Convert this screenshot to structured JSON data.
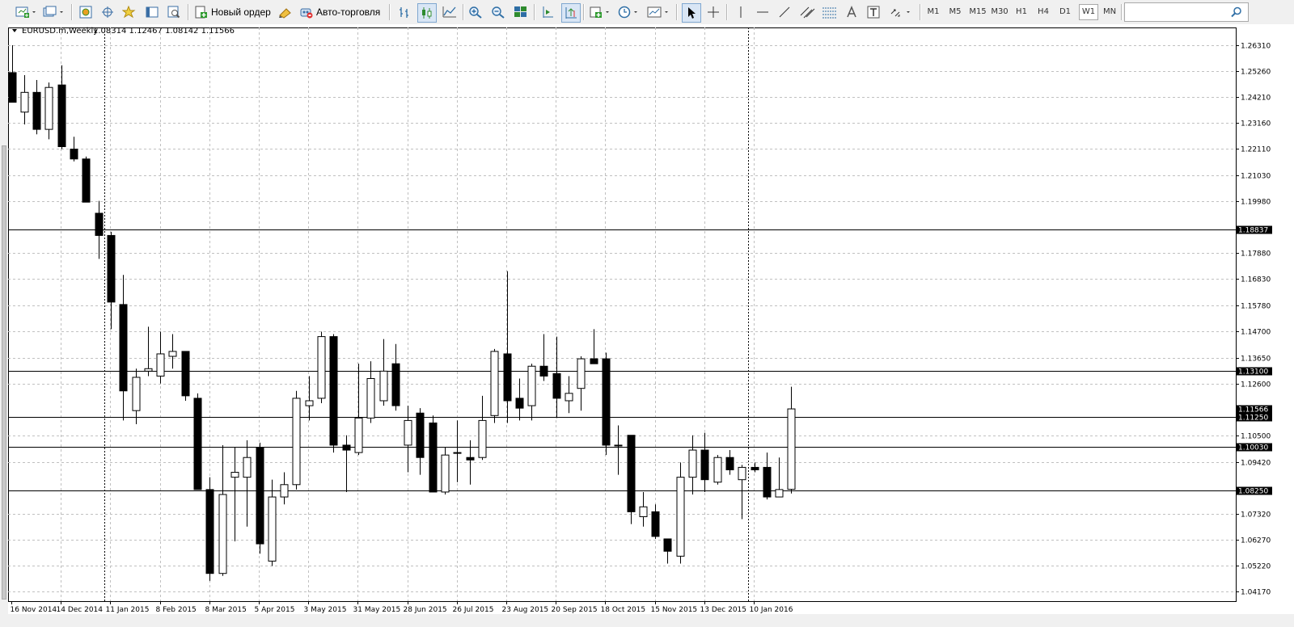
{
  "toolbar": {
    "new_order": "Новый ордер",
    "auto_trading": "Авто-торговля",
    "timeframes": [
      "M1",
      "M5",
      "M15",
      "M30",
      "H1",
      "H4",
      "D1",
      "W1",
      "MN"
    ],
    "active_timeframe": "W1",
    "search_placeholder": ""
  },
  "chart": {
    "title": "EURUSD.m,Weekly",
    "ohlc": "1.08314 1.12467 1.08142 1.11566",
    "bg_color": "#ffffff",
    "grid_color": "#c0c0c0"
  },
  "chart_data": {
    "type": "candlestick",
    "symbol": "EURUSD.m",
    "timeframe": "Weekly",
    "ylim": [
      1.0417,
      1.2631
    ],
    "y_ticks": [
      "1.26310",
      "1.25260",
      "1.24210",
      "1.23160",
      "1.22110",
      "1.21030",
      "1.19980",
      "1.17880",
      "1.16830",
      "1.15780",
      "1.14700",
      "1.13650",
      "1.12600",
      "1.10500",
      "1.09420",
      "1.07320",
      "1.06270",
      "1.05220",
      "1.04170"
    ],
    "x_ticks": [
      "16 Nov 2014",
      "14 Dec 2014",
      "11 Jan 2015",
      "8 Feb 2015",
      "8 Mar 2015",
      "5 Apr 2015",
      "3 May 2015",
      "31 May 2015",
      "28 Jun 2015",
      "26 Jul 2015",
      "23 Aug 2015",
      "20 Sep 2015",
      "18 Oct 2015",
      "15 Nov 2015",
      "13 Dec 2015",
      "10 Jan 2016"
    ],
    "horizontal_lines": [
      {
        "price": 1.18837,
        "label": "1.18837"
      },
      {
        "price": 1.131,
        "label": "1.13100"
      },
      {
        "price": 1.1125,
        "label": "1.11250"
      },
      {
        "price": 1.1003,
        "label": "1.10030"
      },
      {
        "price": 1.0825,
        "label": "1.08250"
      }
    ],
    "current_price": {
      "price": 1.11566,
      "label": "1.11566"
    },
    "vertical_lines": [
      {
        "after_week": 7
      },
      {
        "after_week": 59
      }
    ],
    "candles": [
      {
        "o": 1.252,
        "h": 1.2631,
        "l": 1.24,
        "c": 1.24
      },
      {
        "o": 1.236,
        "h": 1.251,
        "l": 1.231,
        "c": 1.244
      },
      {
        "o": 1.244,
        "h": 1.249,
        "l": 1.227,
        "c": 1.229
      },
      {
        "o": 1.229,
        "h": 1.248,
        "l": 1.225,
        "c": 1.246
      },
      {
        "o": 1.247,
        "h": 1.255,
        "l": 1.221,
        "c": 1.222
      },
      {
        "o": 1.221,
        "h": 1.226,
        "l": 1.216,
        "c": 1.217
      },
      {
        "o": 1.217,
        "h": 1.218,
        "l": 1.2,
        "c": 1.1995
      },
      {
        "o": 1.195,
        "h": 1.2,
        "l": 1.1765,
        "c": 1.186
      },
      {
        "o": 1.186,
        "h": 1.1875,
        "l": 1.148,
        "c": 1.159
      },
      {
        "o": 1.158,
        "h": 1.17,
        "l": 1.111,
        "c": 1.123
      },
      {
        "o": 1.115,
        "h": 1.132,
        "l": 1.1095,
        "c": 1.1285
      },
      {
        "o": 1.131,
        "h": 1.149,
        "l": 1.129,
        "c": 1.132
      },
      {
        "o": 1.129,
        "h": 1.147,
        "l": 1.126,
        "c": 1.138
      },
      {
        "o": 1.137,
        "h": 1.146,
        "l": 1.132,
        "c": 1.139
      },
      {
        "o": 1.139,
        "h": 1.139,
        "l": 1.119,
        "c": 1.121
      },
      {
        "o": 1.12,
        "h": 1.122,
        "l": 1.083,
        "c": 1.083
      },
      {
        "o": 1.083,
        "h": 1.088,
        "l": 1.046,
        "c": 1.049
      },
      {
        "o": 1.049,
        "h": 1.101,
        "l": 1.048,
        "c": 1.081
      },
      {
        "o": 1.088,
        "h": 1.1,
        "l": 1.062,
        "c": 1.09
      },
      {
        "o": 1.088,
        "h": 1.103,
        "l": 1.068,
        "c": 1.096
      },
      {
        "o": 1.1,
        "h": 1.102,
        "l": 1.057,
        "c": 1.061
      },
      {
        "o": 1.054,
        "h": 1.087,
        "l": 1.052,
        "c": 1.08
      },
      {
        "o": 1.08,
        "h": 1.09,
        "l": 1.077,
        "c": 1.085
      },
      {
        "o": 1.085,
        "h": 1.123,
        "l": 1.083,
        "c": 1.12
      },
      {
        "o": 1.117,
        "h": 1.129,
        "l": 1.111,
        "c": 1.119
      },
      {
        "o": 1.12,
        "h": 1.147,
        "l": 1.118,
        "c": 1.145
      },
      {
        "o": 1.145,
        "h": 1.146,
        "l": 1.098,
        "c": 1.101
      },
      {
        "o": 1.101,
        "h": 1.105,
        "l": 1.082,
        "c": 1.099
      },
      {
        "o": 1.098,
        "h": 1.134,
        "l": 1.097,
        "c": 1.112
      },
      {
        "o": 1.112,
        "h": 1.135,
        "l": 1.11,
        "c": 1.128
      },
      {
        "o": 1.119,
        "h": 1.144,
        "l": 1.117,
        "c": 1.131
      },
      {
        "o": 1.134,
        "h": 1.142,
        "l": 1.115,
        "c": 1.117
      },
      {
        "o": 1.101,
        "h": 1.117,
        "l": 1.09,
        "c": 1.111
      },
      {
        "o": 1.114,
        "h": 1.116,
        "l": 1.089,
        "c": 1.096
      },
      {
        "o": 1.11,
        "h": 1.113,
        "l": 1.082,
        "c": 1.082
      },
      {
        "o": 1.082,
        "h": 1.1,
        "l": 1.081,
        "c": 1.097
      },
      {
        "o": 1.098,
        "h": 1.111,
        "l": 1.086,
        "c": 1.098
      },
      {
        "o": 1.096,
        "h": 1.103,
        "l": 1.085,
        "c": 1.095
      },
      {
        "o": 1.096,
        "h": 1.121,
        "l": 1.095,
        "c": 1.111
      },
      {
        "o": 1.113,
        "h": 1.14,
        "l": 1.11,
        "c": 1.139
      },
      {
        "o": 1.138,
        "h": 1.1715,
        "l": 1.11,
        "c": 1.119
      },
      {
        "o": 1.12,
        "h": 1.128,
        "l": 1.111,
        "c": 1.116
      },
      {
        "o": 1.117,
        "h": 1.134,
        "l": 1.111,
        "c": 1.133
      },
      {
        "o": 1.133,
        "h": 1.146,
        "l": 1.127,
        "c": 1.129
      },
      {
        "o": 1.13,
        "h": 1.145,
        "l": 1.112,
        "c": 1.12
      },
      {
        "o": 1.119,
        "h": 1.129,
        "l": 1.114,
        "c": 1.122
      },
      {
        "o": 1.124,
        "h": 1.137,
        "l": 1.115,
        "c": 1.136
      },
      {
        "o": 1.136,
        "h": 1.148,
        "l": 1.134,
        "c": 1.134
      },
      {
        "o": 1.136,
        "h": 1.1385,
        "l": 1.097,
        "c": 1.101
      },
      {
        "o": 1.101,
        "h": 1.109,
        "l": 1.089,
        "c": 1.101
      },
      {
        "o": 1.105,
        "h": 1.105,
        "l": 1.069,
        "c": 1.074
      },
      {
        "o": 1.072,
        "h": 1.082,
        "l": 1.068,
        "c": 1.076
      },
      {
        "o": 1.074,
        "h": 1.077,
        "l": 1.063,
        "c": 1.064
      },
      {
        "o": 1.063,
        "h": 1.063,
        "l": 1.053,
        "c": 1.058
      },
      {
        "o": 1.056,
        "h": 1.094,
        "l": 1.053,
        "c": 1.088
      },
      {
        "o": 1.088,
        "h": 1.105,
        "l": 1.081,
        "c": 1.099
      },
      {
        "o": 1.099,
        "h": 1.106,
        "l": 1.082,
        "c": 1.087
      },
      {
        "o": 1.086,
        "h": 1.097,
        "l": 1.085,
        "c": 1.096
      },
      {
        "o": 1.096,
        "h": 1.099,
        "l": 1.089,
        "c": 1.091
      },
      {
        "o": 1.087,
        "h": 1.093,
        "l": 1.071,
        "c": 1.092
      },
      {
        "o": 1.092,
        "h": 1.094,
        "l": 1.09,
        "c": 1.091
      },
      {
        "o": 1.092,
        "h": 1.098,
        "l": 1.079,
        "c": 1.08
      },
      {
        "o": 1.08,
        "h": 1.096,
        "l": 1.08,
        "c": 1.083
      },
      {
        "o": 1.0831,
        "h": 1.1247,
        "l": 1.0814,
        "c": 1.1157
      }
    ]
  }
}
